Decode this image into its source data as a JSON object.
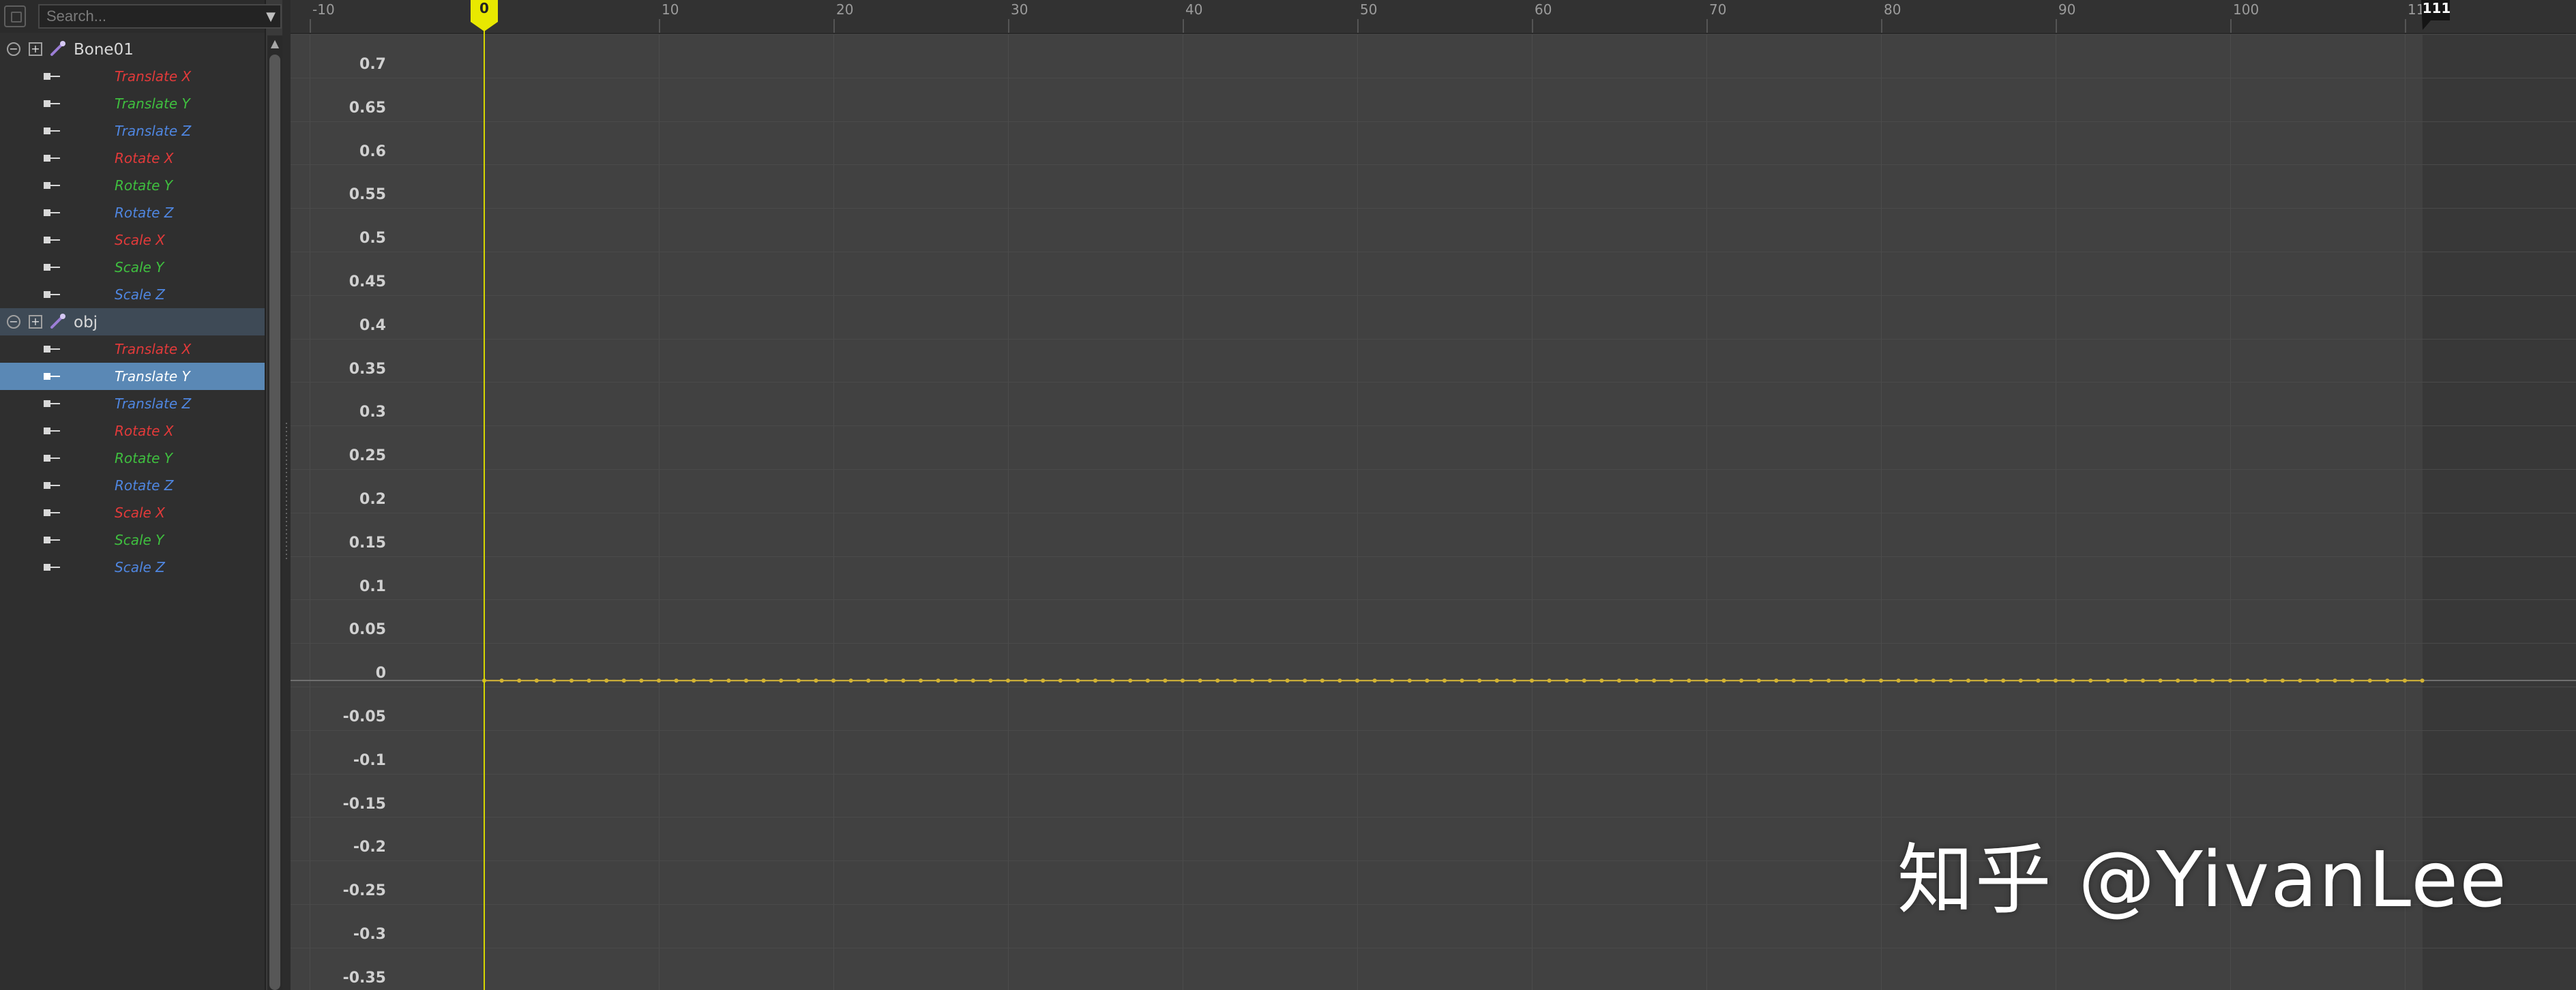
{
  "search": {
    "placeholder": "Search..."
  },
  "tree": {
    "nodes": [
      {
        "label": "Bone01",
        "tracks": [
          {
            "label": "Translate X",
            "axis": "x"
          },
          {
            "label": "Translate Y",
            "axis": "y"
          },
          {
            "label": "Translate Z",
            "axis": "z"
          },
          {
            "label": "Rotate X",
            "axis": "x"
          },
          {
            "label": "Rotate Y",
            "axis": "y"
          },
          {
            "label": "Rotate Z",
            "axis": "z"
          },
          {
            "label": "Scale X",
            "axis": "x"
          },
          {
            "label": "Scale Y",
            "axis": "y"
          },
          {
            "label": "Scale Z",
            "axis": "z"
          }
        ]
      },
      {
        "label": "obj",
        "tracks": [
          {
            "label": "Translate X",
            "axis": "x"
          },
          {
            "label": "Translate Y",
            "axis": "y",
            "selected": true
          },
          {
            "label": "Translate Z",
            "axis": "z"
          },
          {
            "label": "Rotate X",
            "axis": "x"
          },
          {
            "label": "Rotate Y",
            "axis": "y"
          },
          {
            "label": "Rotate Z",
            "axis": "z"
          },
          {
            "label": "Scale X",
            "axis": "x"
          },
          {
            "label": "Scale Y",
            "axis": "y"
          },
          {
            "label": "Scale Z",
            "axis": "z"
          }
        ]
      }
    ]
  },
  "colors": {
    "axis_x": "#e23a3a",
    "axis_y": "#3fbf3f",
    "axis_z": "#4f86e0",
    "playhead": "#e8e800",
    "keyframe": "#d2b233",
    "selection": "#5a88b5"
  },
  "timeline": {
    "ticks": [
      "-10",
      "10",
      "20",
      "30",
      "40",
      "50",
      "60",
      "70",
      "80",
      "90",
      "100",
      "11"
    ],
    "current_frame": "0",
    "end_frame": "111"
  },
  "graph": {
    "y_labels": [
      "0.7",
      "0.65",
      "0.6",
      "0.55",
      "0.5",
      "0.45",
      "0.4",
      "0.35",
      "0.3",
      "0.25",
      "0.2",
      "0.15",
      "0.1",
      "0.05",
      "0",
      "-0.05",
      "-0.1",
      "-0.15",
      "-0.2",
      "-0.25",
      "-0.3",
      "-0.35"
    ],
    "curve": {
      "track": "Translate Y",
      "frame_start": 0,
      "frame_end": 111,
      "value": 0,
      "keyframe_step": 1
    }
  },
  "watermark": "知乎 @YivanLee"
}
